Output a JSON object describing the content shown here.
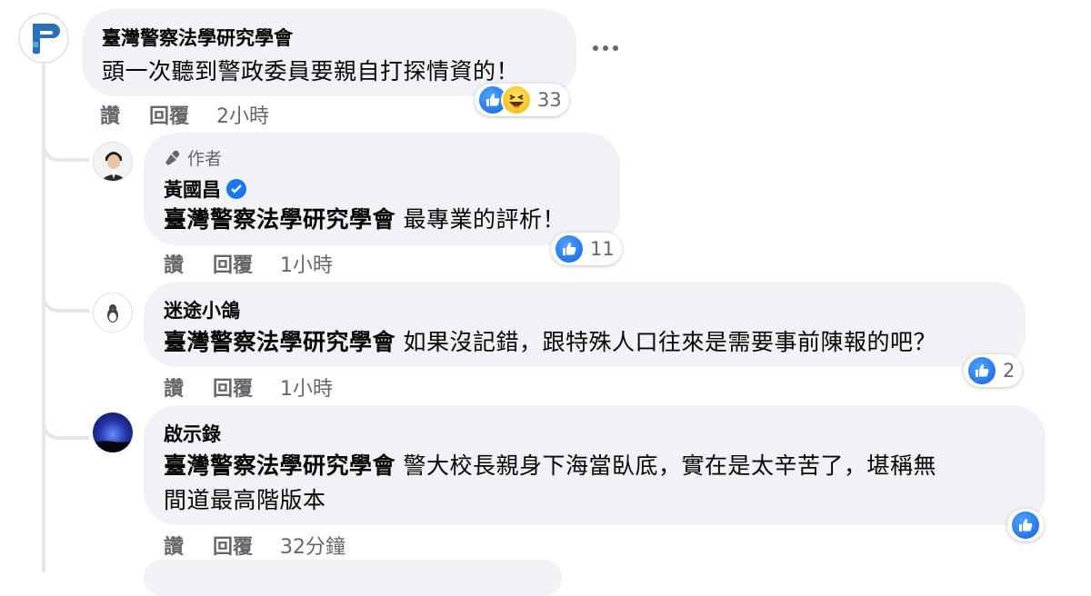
{
  "comments": [
    {
      "author": "臺灣警察法學研究學會",
      "text": "頭一次聽到警政委員要親自打探情資的！",
      "actions": {
        "like": "讚",
        "reply": "回覆",
        "time": "2小時"
      },
      "reactions": {
        "count": "33",
        "types": [
          "like-icon",
          "haha-icon"
        ]
      }
    },
    {
      "author_label": "作者",
      "author": "黃國昌",
      "verified": true,
      "mention": "臺灣警察法學研究學會",
      "text": "最專業的評析！",
      "actions": {
        "like": "讚",
        "reply": "回覆",
        "time": "1小時"
      },
      "reactions": {
        "count": "11",
        "types": [
          "like-icon"
        ]
      }
    },
    {
      "author": "迷途小鴿",
      "mention": "臺灣警察法學研究學會",
      "text": "如果沒記錯，跟特殊人口往來是需要事前陳報的吧？",
      "actions": {
        "like": "讚",
        "reply": "回覆",
        "time": "1小時"
      },
      "reactions": {
        "count": "2",
        "types": [
          "like-icon"
        ]
      }
    },
    {
      "author": "啟示錄",
      "mention": "臺灣警察法學研究學會",
      "text_line1": "警大校長親身下海當臥底，實在是太辛苦了，堪稱無",
      "text_line2": "間道最高階版本",
      "actions": {
        "like": "讚",
        "reply": "回覆",
        "time": "32分鐘"
      },
      "reactions": {
        "count": "",
        "types": [
          "like-icon"
        ]
      }
    }
  ],
  "colors": {
    "accent": "#1877f2",
    "bubble": "#f0f2f5",
    "muted": "#65676b",
    "thread": "#e4e6eb"
  }
}
